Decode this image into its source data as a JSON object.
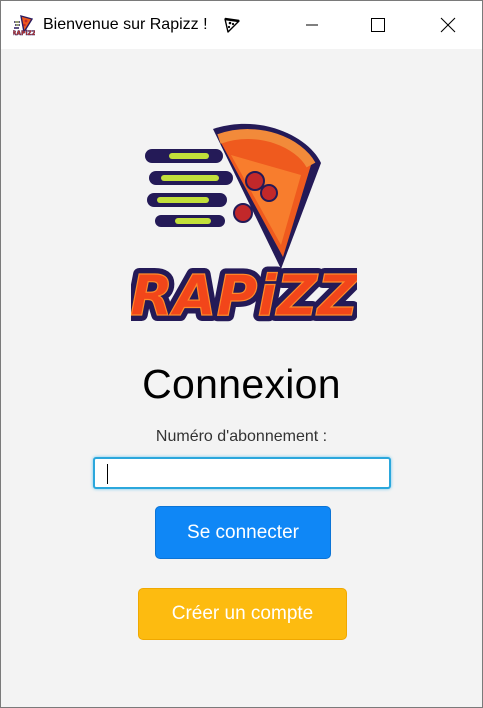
{
  "window": {
    "title": "Bienvenue sur Rapizz !",
    "app_icon": "rapizz-logo-icon",
    "title_emoji": "pizza-emoji-icon",
    "controls": [
      "minimize-icon",
      "maximize-icon",
      "close-icon"
    ]
  },
  "logo": {
    "text": "RAPiZZ",
    "icon": "speeding-pizza-slice-logo"
  },
  "login": {
    "heading": "Connexion",
    "field_label": "Numéro d'abonnement :",
    "field_value": "",
    "login_button": "Se connecter",
    "create_button": "Créer un compte"
  },
  "colors": {
    "login_button": "#0f87f6",
    "create_button": "#fdbb10",
    "input_focus_border": "#2ba7dc",
    "background": "#f3f3f3"
  }
}
